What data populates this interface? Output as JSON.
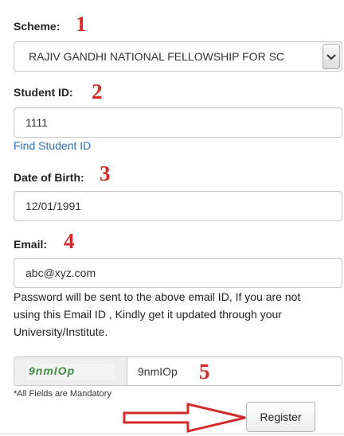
{
  "form": {
    "scheme": {
      "label": "Scheme:",
      "marker": "1",
      "selected": "RAJIV GANDHI NATIONAL FELLOWSHIP FOR SC"
    },
    "student_id": {
      "label": "Student ID:",
      "marker": "2",
      "value": "1111",
      "link": "Find Student ID"
    },
    "dob": {
      "label": "Date of Birth:",
      "marker": "3",
      "value": "12/01/1991"
    },
    "email": {
      "label": "Email:",
      "marker": "4",
      "value": "abc@xyz.com",
      "help_lines": [
        "Password will be sent to the above email ID, If you are not",
        "using this Email ID , Kindly get it updated through your",
        "University/Institute."
      ]
    },
    "captcha": {
      "image_text": "9nmIOp",
      "value": "9nmIOp",
      "marker": "5"
    },
    "mandatory_note": "*All Fields are Mandatory",
    "register_label": "Register"
  },
  "colors": {
    "annotation_red": "#d42a2a",
    "link_blue": "#2f6fb3"
  },
  "icons": {
    "select": "chevron-down-icon",
    "annotation_arrow": "right-arrow-icon"
  }
}
